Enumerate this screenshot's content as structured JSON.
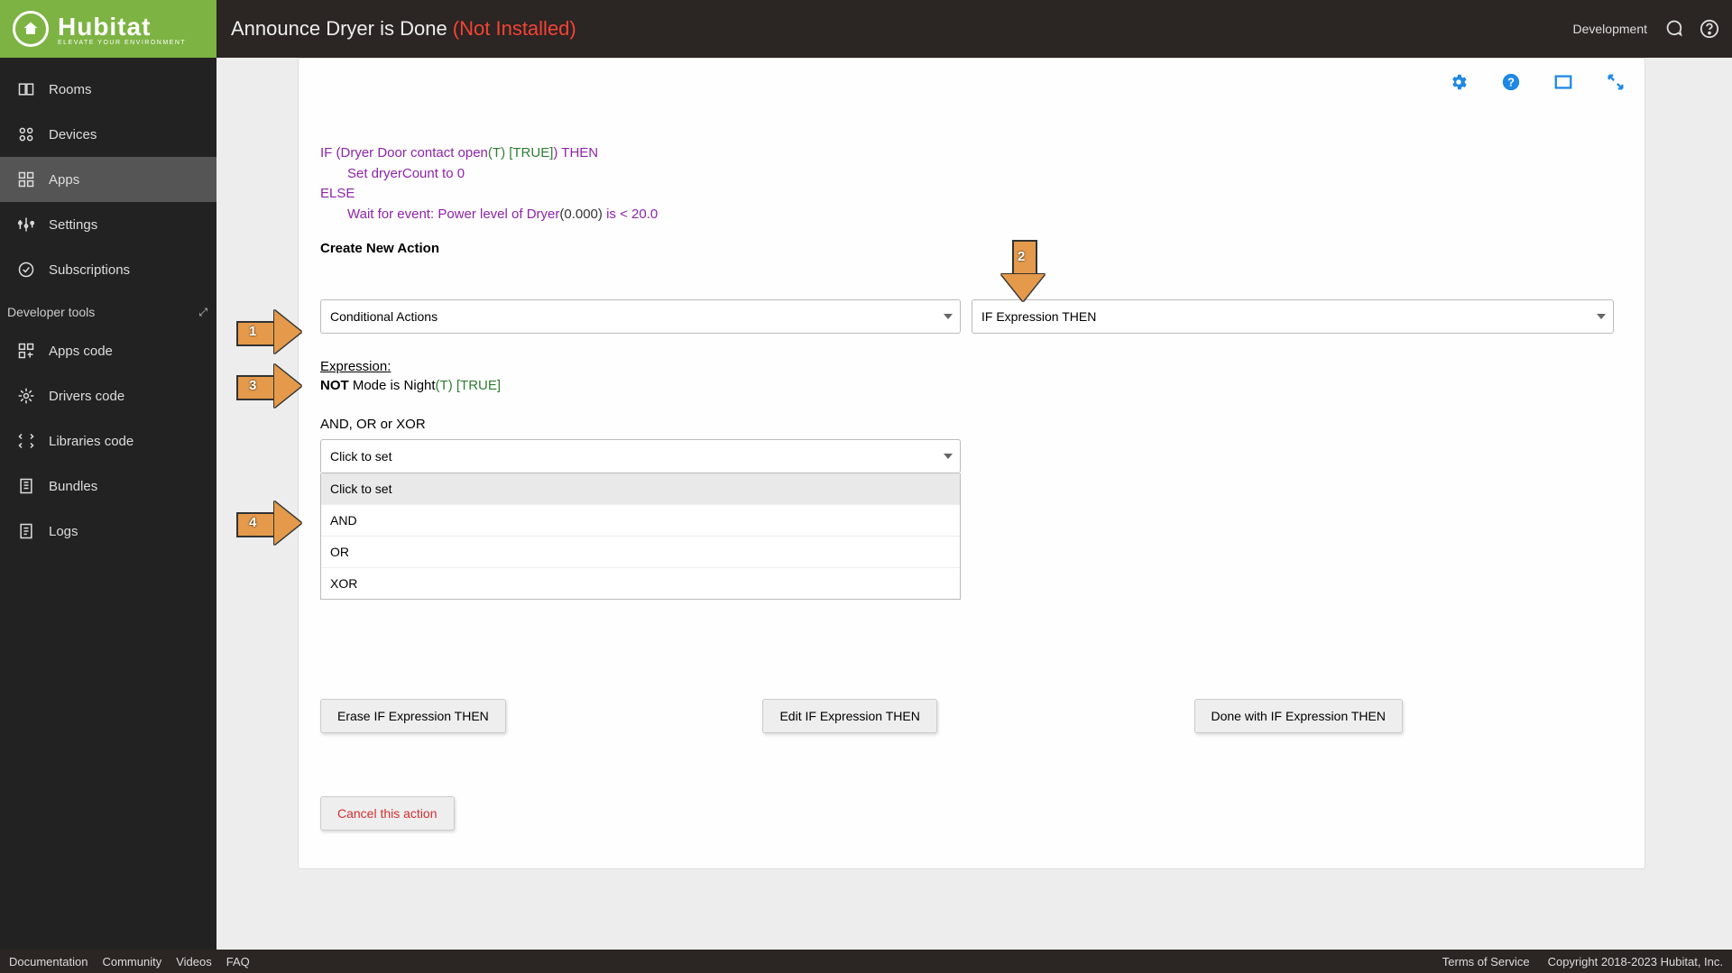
{
  "header": {
    "brand": "Hubitat",
    "brand_sub": "ELEVATE YOUR ENVIRONMENT",
    "title": "Announce Dryer is Done ",
    "status": "(Not Installed)",
    "right_label": "Development"
  },
  "sidebar": {
    "items": [
      {
        "label": "Rooms"
      },
      {
        "label": "Devices"
      },
      {
        "label": "Apps"
      },
      {
        "label": "Settings"
      },
      {
        "label": "Subscriptions"
      }
    ],
    "dev_header": "Developer tools",
    "dev_items": [
      {
        "label": "Apps code"
      },
      {
        "label": "Drivers code"
      },
      {
        "label": "Libraries code"
      },
      {
        "label": "Bundles"
      },
      {
        "label": "Logs"
      }
    ]
  },
  "footer": {
    "links": [
      "Documentation",
      "Community",
      "Videos",
      "FAQ"
    ],
    "right": [
      "Terms of Service",
      "Copyright 2018-2023 Hubitat, Inc."
    ]
  },
  "code": {
    "l1a": "IF (Dryer Door contact open",
    "l1b": "(T)",
    "l1c": " [TRUE]",
    "l1d": ") THEN",
    "l2": "Set dryerCount to 0",
    "l3": "ELSE",
    "l4a": "Wait for event: Power level of Dryer",
    "l4b": "(0.000) ",
    "l4c": "is < 20.0"
  },
  "create_action": "Create New Action",
  "selects": {
    "left": "Conditional Actions",
    "right": "IF Expression THEN"
  },
  "expression": {
    "label": "Expression",
    "not": "NOT",
    "body": " Mode is Night",
    "trueflag": "(T) [TRUE]"
  },
  "aox": {
    "label": "AND, OR or XOR",
    "selected": "Click to set",
    "options": [
      "Click to set",
      "AND",
      "OR",
      "XOR"
    ]
  },
  "buttons": {
    "erase": "Erase IF Expression THEN",
    "edit": "Edit IF Expression THEN",
    "done": "Done with IF Expression THEN",
    "cancel": "Cancel this action"
  },
  "arrows": {
    "a1": "1",
    "a2": "2",
    "a3": "3",
    "a4": "4"
  }
}
